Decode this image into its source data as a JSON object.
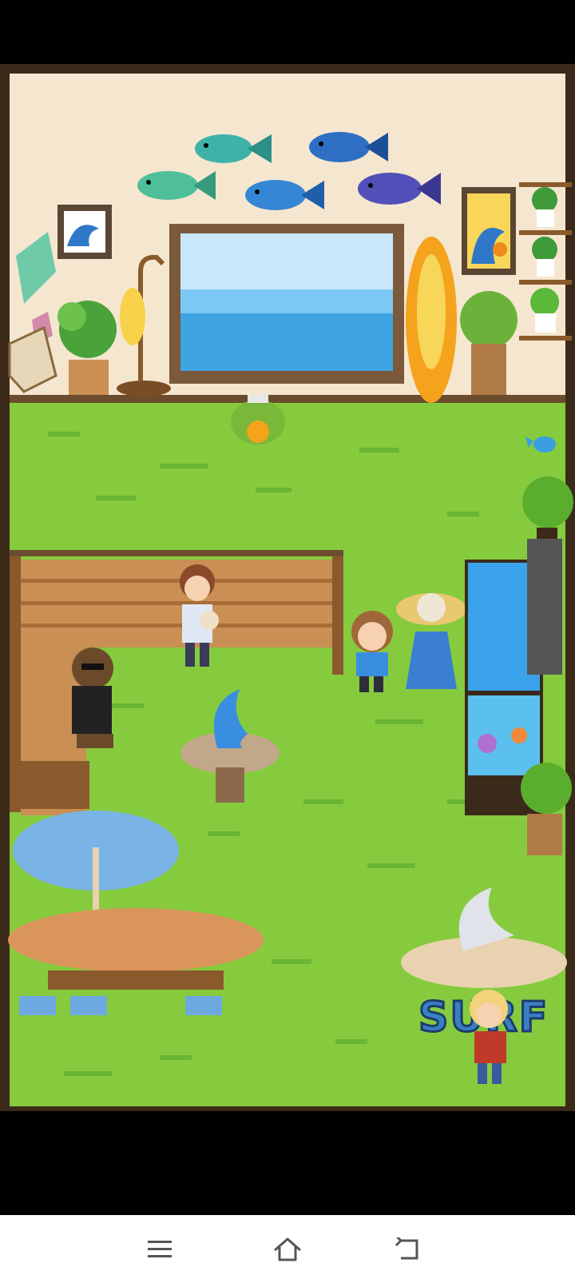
{
  "scene": {
    "surf_sign_text": "SURF",
    "colors": {
      "wall": "#f5e6cf",
      "grass": "#86cb3e",
      "grass_dark": "#5fa82a",
      "wood": "#c98f55",
      "wood_dark": "#8a5a2c",
      "frame": "#6b4d2e",
      "water": "#4aa8e6"
    }
  },
  "wall_decor": {
    "fish": [
      "teal-fish",
      "blue-fish",
      "green-fish",
      "blue-fish",
      "purple-fish"
    ],
    "items": [
      "wave-painting-left",
      "wave-painting-right",
      "window-ocean-view",
      "surfboard",
      "fish-lamp",
      "potted-plants"
    ]
  },
  "characters": [
    "girl-holding-baby",
    "brown-haired-child",
    "woman-in-sunhat",
    "bigfoot-in-sunglasses",
    "blond-man-red-shirt",
    "frog-lantern"
  ],
  "navigation": {
    "menu_icon": "menu-icon",
    "home_icon": "home-icon",
    "back_icon": "back-icon"
  }
}
